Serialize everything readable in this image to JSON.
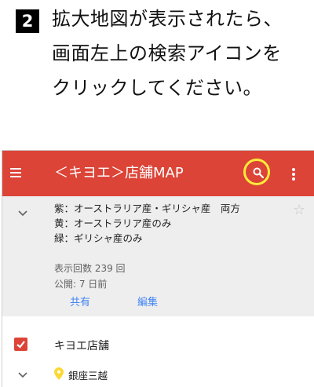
{
  "step": {
    "number": "2",
    "instruction": "拡大地図が表示されたら、\n画面左上の検索アイコンを\nクリックしてください。"
  },
  "appbar": {
    "title": "＜キヨエ＞店舗MAP",
    "background_color": "#db4437",
    "highlight_color": "#ffeb3b"
  },
  "info_card": {
    "description_lines": [
      "紫：オーストラリア産・ギリシャ産　両方",
      "黄：オーストラリア産のみ",
      "緑：ギリシャ産のみ"
    ],
    "view_count": "表示回数 239 回",
    "published": "公開: 7 日前",
    "share_label": "共有",
    "edit_label": "編集"
  },
  "layer": {
    "title": "キヨエ店舗",
    "checked": true
  },
  "place": {
    "label": "銀座三越",
    "pin_color": "#fdd835"
  }
}
